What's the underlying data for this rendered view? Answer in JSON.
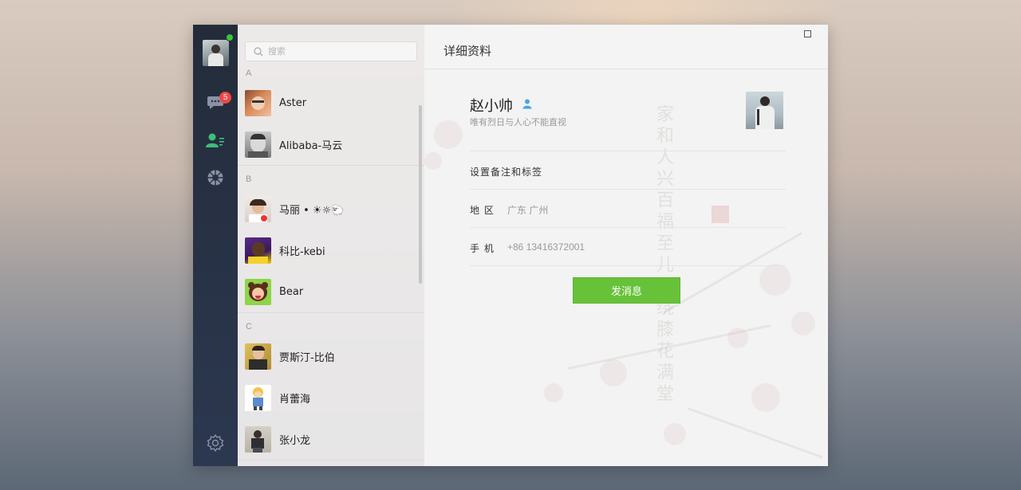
{
  "sidebar": {
    "unread_badge": "5",
    "icons": [
      "chat-icon",
      "contacts-icon",
      "moments-icon",
      "settings-icon"
    ]
  },
  "search": {
    "placeholder": "搜索"
  },
  "contacts": {
    "groups": [
      {
        "letter": "A",
        "items": [
          {
            "name": "Aster"
          },
          {
            "name": "Alibaba-马云"
          }
        ]
      },
      {
        "letter": "B",
        "items": [
          {
            "name": "马丽 • ☀☼🐑"
          },
          {
            "name": "科比-kebi"
          },
          {
            "name": "Bear"
          }
        ]
      },
      {
        "letter": "C",
        "items": [
          {
            "name": "贾斯汀-比伯"
          },
          {
            "name": "肖蕾海"
          },
          {
            "name": "张小龙"
          }
        ]
      }
    ]
  },
  "detail": {
    "header_title": "详细资料",
    "name": "赵小帅",
    "signature": "唯有烈日与人心不能直视",
    "remark_label": "设置备注和标签",
    "region_label": "地 区",
    "region_value": "广东 广州",
    "phone_label": "手 机",
    "phone_value": "+86 13416372001",
    "send_button": "发消息"
  },
  "colors": {
    "sidebar_bg": "#242c3a",
    "accent_green": "#67c23a",
    "badge_red": "#f54545",
    "online_green": "#3bc43b"
  }
}
